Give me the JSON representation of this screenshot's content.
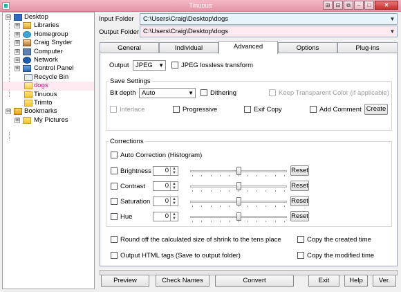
{
  "window": {
    "title": "Tinuous",
    "title_bar_color": "#e594a6"
  },
  "window_buttons": [
    "⊞",
    "⊟",
    "⧉",
    "‒",
    "□",
    "✕"
  ],
  "tree": {
    "nodes": [
      {
        "label": "Desktop",
        "expander": "⊟",
        "icon": "desktop-icon"
      },
      {
        "label": "Libraries",
        "expander": "⊞",
        "icon": "libraries-icon"
      },
      {
        "label": "Homegroup",
        "expander": "⊞",
        "icon": "homegroup-icon"
      },
      {
        "label": "Craig Snyder",
        "expander": "⊞",
        "icon": "user-folder-icon"
      },
      {
        "label": "Computer",
        "expander": "⊞",
        "icon": "computer-icon"
      },
      {
        "label": "Network",
        "expander": "⊞",
        "icon": "network-icon"
      },
      {
        "label": "Control Panel",
        "expander": "⊞",
        "icon": "control-panel-icon"
      },
      {
        "label": "Recycle Bin",
        "expander": "",
        "icon": "recycle-bin-icon"
      },
      {
        "label": "dogs",
        "expander": "",
        "icon": "folder-icon",
        "selected": true
      },
      {
        "label": "Tinuous",
        "expander": "",
        "icon": "folder-icon"
      },
      {
        "label": "Trimto",
        "expander": "",
        "icon": "folder-icon"
      },
      {
        "label": "Bookmarks",
        "expander": "⊟",
        "icon": "bookmarks-icon"
      },
      {
        "label": "My Pictures",
        "expander": "⊞",
        "icon": "pictures-folder-icon"
      }
    ],
    "selected_label_color": "#c21f7a"
  },
  "input_folder": {
    "label": "Input Folder",
    "value": "C:\\Users\\Craig\\Desktop\\dogs",
    "bg": "#e8f4fb"
  },
  "output_folder": {
    "label": "Output Folder",
    "value": "C:\\Users\\Craig\\Desktop\\dogs",
    "bg": "#fde9ef"
  },
  "tabs": [
    {
      "label": "General",
      "active": false
    },
    {
      "label": "Individual",
      "active": false
    },
    {
      "label": "Advanced",
      "active": true
    },
    {
      "label": "Options",
      "active": false
    },
    {
      "label": "Plug-ins",
      "active": false
    }
  ],
  "advanced": {
    "output_label": "Output",
    "output_format": "JPEG",
    "jpeg_lossless_label": "JPEG lossless transform",
    "save_settings": {
      "title": "Save Settings",
      "bit_depth_label": "Bit depth",
      "bit_depth_value": "Auto",
      "dithering_label": "Dithering",
      "keep_transparent_label": "Keep Transparent Color (if applicable)",
      "interlace_label": "Interlace",
      "progressive_label": "Progressive",
      "exif_copy_label": "Exif Copy",
      "add_comment_label": "Add Comment",
      "create_button": "Create"
    },
    "corrections": {
      "title": "Corrections",
      "auto_correction_label": "Auto Correction (Histogram)",
      "sliders": [
        {
          "label": "Brightness",
          "value": "0",
          "level": 0.5,
          "reset": "Reset"
        },
        {
          "label": "Contrast",
          "value": "0",
          "level": 0.5,
          "reset": "Reset"
        },
        {
          "label": "Saturation",
          "value": "0",
          "level": 0.5,
          "reset": "Reset"
        },
        {
          "label": "Hue",
          "value": "0",
          "level": 0.5,
          "reset": "Reset"
        }
      ]
    },
    "round_off_label": "Round off the calculated size of shrink to the tens place",
    "copy_created_label": "Copy the created time",
    "output_html_label": "Output HTML tags (Save to output folder)",
    "copy_modified_label": "Copy the modified time"
  },
  "progress": {
    "value": 0
  },
  "buttons": {
    "preview": "Preview",
    "check_names": "Check Names",
    "convert": "Convert",
    "exit": "Exit",
    "help": "Help",
    "ver": "Ver."
  }
}
